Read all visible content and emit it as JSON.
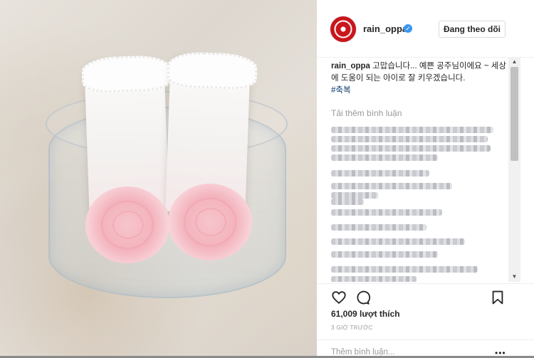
{
  "post": {
    "username": "rain_oppa",
    "verified_glyph": "✓",
    "follow_label": "Đang theo dõi",
    "caption_user": "rain_oppa",
    "caption_text": "고맙습니다... 예쁜 공주님이에요 ~ 세상에 도움이 되는 아이로 잘 키우겠습니다.",
    "hashtag": "#축복",
    "load_more_label": "Tải thêm bình luận",
    "likes_label": "61,009 lượt thích",
    "time_label": "3 GIỜ TRƯỚC",
    "add_comment_placeholder": "Thêm bình luận...",
    "more_label": "•••"
  },
  "scroll": {
    "up": "▲",
    "down": "▼"
  },
  "icons": {
    "avatar": "avatar-red-disc",
    "verified": "verified-badge-icon",
    "like": "heart-icon",
    "comment": "comment-bubble-icon",
    "save": "bookmark-icon",
    "options": "more-options-icon"
  },
  "colors": {
    "verified_blue": "#3897f0",
    "hashtag": "#003569",
    "muted_text": "#999999",
    "avatar_red": "#c9161c"
  }
}
